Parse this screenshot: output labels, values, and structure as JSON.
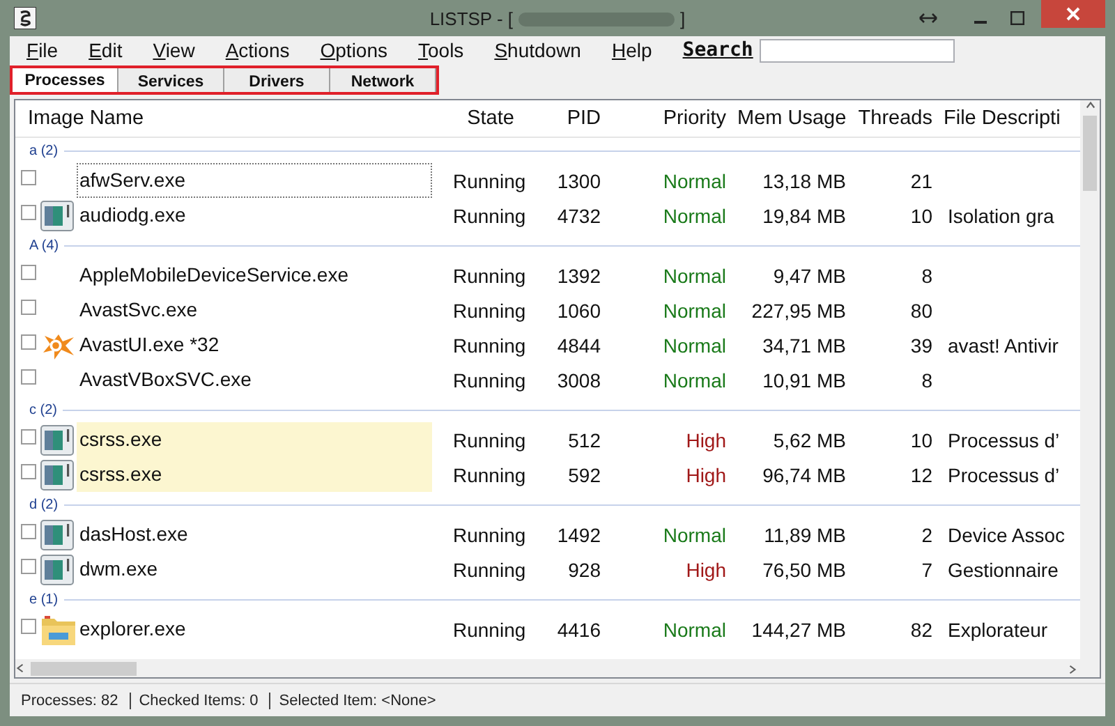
{
  "window": {
    "title": "LISTSP - [",
    "title_end": "]"
  },
  "menu": [
    {
      "label": "File"
    },
    {
      "label": "Edit"
    },
    {
      "label": "View"
    },
    {
      "label": "Actions"
    },
    {
      "label": "Options"
    },
    {
      "label": "Tools"
    },
    {
      "label": "Shutdown"
    },
    {
      "label": "Help"
    }
  ],
  "search": {
    "label": "Search"
  },
  "tabs": [
    {
      "label": "Processes",
      "selected": true
    },
    {
      "label": "Services",
      "selected": false
    },
    {
      "label": "Drivers",
      "selected": false
    },
    {
      "label": "Network",
      "selected": false
    }
  ],
  "columns": [
    "Image Name",
    "State",
    "PID",
    "Priority",
    "Mem Usage",
    "Threads",
    "File Descripti"
  ],
  "groups": [
    {
      "label": "a (2)",
      "rows": [
        {
          "kind": "plain",
          "name": "afwServ.exe",
          "state": "Running",
          "pid": "1300",
          "priority": {
            "text": "Normal",
            "color": "#1a7a1a"
          },
          "mem": "13,18 MB",
          "threads": "21",
          "checked": false,
          "highlighted": false,
          "focused": true
        },
        {
          "kind": "app",
          "name": "audiodg.exe",
          "state": "Running",
          "pid": "4732",
          "priority": {
            "text": "Normal",
            "color": "#1a7a1a"
          },
          "mem": "19,84 MB",
          "threads": "10",
          "description": "Isolation gra",
          "checked": false,
          "highlighted": false,
          "focused": false
        }
      ]
    },
    {
      "label": "A (4)",
      "rows": [
        {
          "kind": "plain",
          "name": "AppleMobileDeviceService.exe",
          "state": "Running",
          "pid": "1392",
          "priority": {
            "text": "Normal",
            "color": "#1a7a1a"
          },
          "mem": "9,47 MB",
          "threads": "8",
          "checked": false,
          "highlighted": false,
          "focused": false
        },
        {
          "kind": "plain",
          "name": "AvastSvc.exe",
          "state": "Running",
          "pid": "1060",
          "priority": {
            "text": "Normal",
            "color": "#1a7a1a"
          },
          "mem": "227,95 MB",
          "threads": "80",
          "checked": false,
          "highlighted": false,
          "focused": false
        },
        {
          "kind": "avast",
          "name": "AvastUI.exe *32",
          "state": "Running",
          "pid": "4844",
          "priority": {
            "text": "Normal",
            "color": "#1a7a1a"
          },
          "mem": "34,71 MB",
          "threads": "39",
          "description": "avast! Antivir",
          "checked": false,
          "highlighted": false,
          "focused": false
        },
        {
          "kind": "plain",
          "name": "AvastVBoxSVC.exe",
          "state": "Running",
          "pid": "3008",
          "priority": {
            "text": "Normal",
            "color": "#1a7a1a"
          },
          "mem": "10,91 MB",
          "threads": "8",
          "checked": false,
          "highlighted": false,
          "focused": false
        }
      ]
    },
    {
      "label": "c (2)",
      "rows": [
        {
          "kind": "app",
          "name": "csrss.exe",
          "state": "Running",
          "pid": "512",
          "priority": {
            "text": "High",
            "color": "#a01818"
          },
          "mem": "5,62 MB",
          "threads": "10",
          "description": "Processus d’",
          "checked": false,
          "highlighted": true,
          "focused": false
        },
        {
          "kind": "app",
          "name": "csrss.exe",
          "state": "Running",
          "pid": "592",
          "priority": {
            "text": "High",
            "color": "#a01818"
          },
          "mem": "96,74 MB",
          "threads": "12",
          "description": "Processus d’",
          "checked": false,
          "highlighted": true,
          "focused": false
        }
      ]
    },
    {
      "label": "d (2)",
      "rows": [
        {
          "kind": "app",
          "name": "dasHost.exe",
          "state": "Running",
          "pid": "1492",
          "priority": {
            "text": "Normal",
            "color": "#1a7a1a"
          },
          "mem": "11,89 MB",
          "threads": "2",
          "description": "Device Assoc",
          "checked": false,
          "highlighted": false,
          "focused": false
        },
        {
          "kind": "app",
          "name": "dwm.exe",
          "state": "Running",
          "pid": "928",
          "priority": {
            "text": "High",
            "color": "#a01818"
          },
          "mem": "76,50 MB",
          "threads": "7",
          "description": "Gestionnaire",
          "checked": false,
          "highlighted": false,
          "focused": false
        }
      ]
    },
    {
      "label": "e (1)",
      "rows": [
        {
          "kind": "folder",
          "name": "explorer.exe",
          "state": "Running",
          "pid": "4416",
          "priority": {
            "text": "Normal",
            "color": "#1a7a1a"
          },
          "mem": "144,27 MB",
          "threads": "82",
          "description": "Explorateur",
          "checked": false,
          "highlighted": false,
          "focused": false
        }
      ]
    }
  ],
  "status_bar": [
    "Processes: 82",
    "Checked Items: 0",
    "Selected Item: <None>"
  ]
}
